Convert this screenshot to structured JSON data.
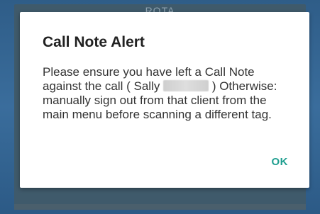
{
  "background": {
    "partial_text": "ROTA"
  },
  "dialog": {
    "title": "Call Note Alert",
    "message_part1": "Please ensure you have left a Call Note against the call ( Sally ",
    "message_part2": " ) Otherwise:  manually sign out from that client from the main menu before scanning a different tag.",
    "ok_label": "OK"
  },
  "colors": {
    "accent": "#1e9e8f",
    "frame": "#2f5d88",
    "backdrop": "#3f5a6b"
  }
}
